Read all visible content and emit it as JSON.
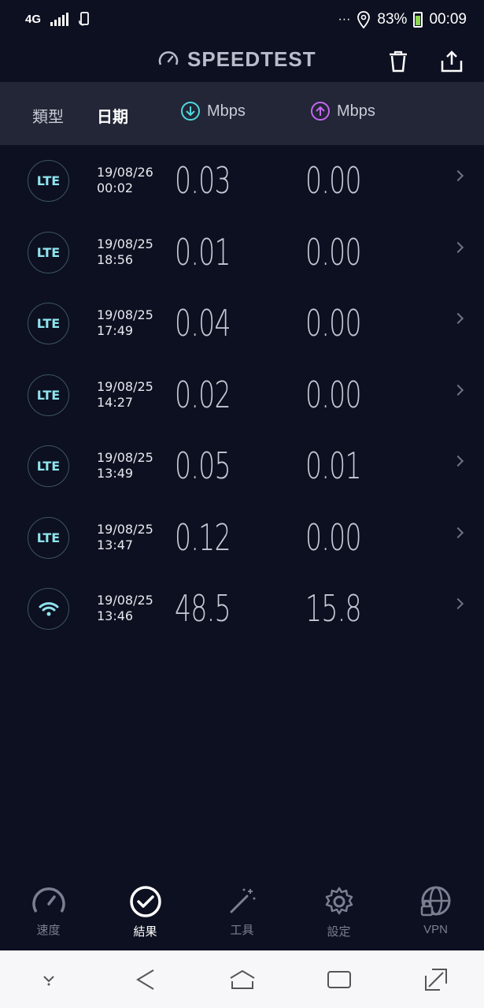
{
  "status_bar": {
    "network": "4G",
    "battery": "83%",
    "time": "00:09",
    "more": "···"
  },
  "app": {
    "title": "SPEEDTEST",
    "icons": [
      "speedometer-icon",
      "trash-icon",
      "share-icon"
    ]
  },
  "columns": {
    "type": "類型",
    "date": "日期",
    "download_unit": "Mbps",
    "upload_unit": "Mbps",
    "colors": {
      "download": "#4fd8e0",
      "upload": "#c467f0"
    }
  },
  "results": [
    {
      "type": "LTE",
      "date": "19/08/26",
      "time": "00:02",
      "download": "0.03",
      "upload": "0.00"
    },
    {
      "type": "LTE",
      "date": "19/08/25",
      "time": "18:56",
      "download": "0.01",
      "upload": "0.00"
    },
    {
      "type": "LTE",
      "date": "19/08/25",
      "time": "17:49",
      "download": "0.04",
      "upload": "0.00"
    },
    {
      "type": "LTE",
      "date": "19/08/25",
      "time": "14:27",
      "download": "0.02",
      "upload": "0.00"
    },
    {
      "type": "LTE",
      "date": "19/08/25",
      "time": "13:49",
      "download": "0.05",
      "upload": "0.01"
    },
    {
      "type": "LTE",
      "date": "19/08/25",
      "time": "13:47",
      "download": "0.12",
      "upload": "0.00"
    },
    {
      "type": "wifi",
      "date": "19/08/25",
      "time": "13:46",
      "download": "48.5",
      "upload": "15.8"
    }
  ],
  "bottom_nav": [
    {
      "label": "速度",
      "icon": "speedometer-icon"
    },
    {
      "label": "結果",
      "icon": "check-circle-icon",
      "active": true
    },
    {
      "label": "工具",
      "icon": "magic-wand-icon"
    },
    {
      "label": "設定",
      "icon": "gear-icon"
    },
    {
      "label": "VPN",
      "icon": "globe-lock-icon"
    }
  ]
}
